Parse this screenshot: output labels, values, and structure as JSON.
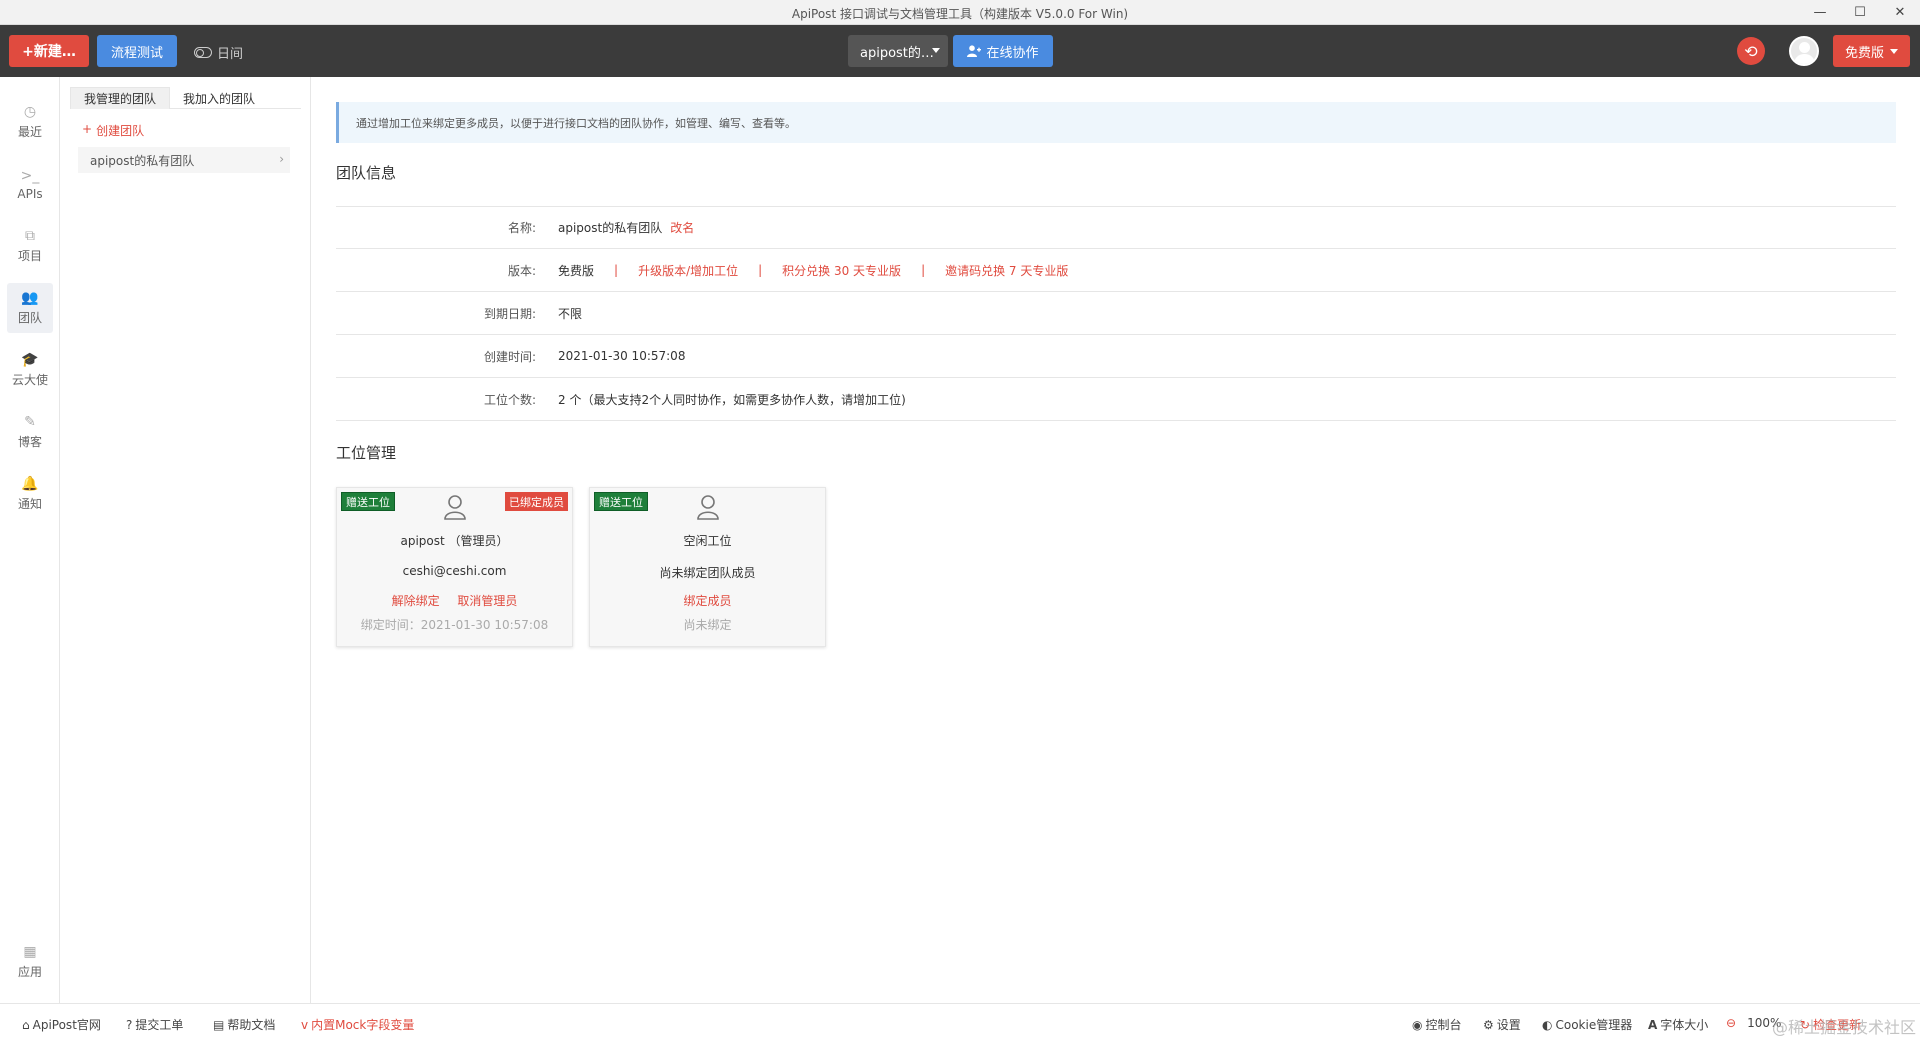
{
  "window": {
    "title": "ApiPost 接口调试与文档管理工具（构建版本 V5.0.0 For Win)",
    "minimize": "—",
    "maximize": "☐",
    "close": "✕"
  },
  "toolbar": {
    "new_label": "+新建…",
    "flow_test_label": "流程测试",
    "night_label": "日间",
    "project_select": "apipost的…",
    "collab_label": "在线协作",
    "plan_label": "免费版"
  },
  "leftnav": [
    {
      "label": "最近",
      "icon": "clock-icon"
    },
    {
      "label": "APIs",
      "icon": "terminal-icon"
    },
    {
      "label": "项目",
      "icon": "project-icon"
    },
    {
      "label": "团队",
      "icon": "users-icon"
    },
    {
      "label": "云大使",
      "icon": "graduation-cap-icon"
    },
    {
      "label": "博客",
      "icon": "edit-icon"
    },
    {
      "label": "通知",
      "icon": "bell-icon"
    },
    {
      "label": "应用",
      "icon": "apps-grid-icon"
    }
  ],
  "subpanel": {
    "tabs": [
      "我管理的团队",
      "我加入的团队"
    ],
    "create_team": "创建团队",
    "teams": [
      "apipost的私有团队"
    ]
  },
  "main": {
    "notice": "通过增加工位来绑定更多成员，以便于进行接口文档的团队协作，如管理、编写、查看等。",
    "team_info_title": "团队信息",
    "rows": {
      "name_label": "名称:",
      "name_value": "apipost的私有团队",
      "rename": "改名",
      "version_label": "版本:",
      "version_value": "免费版",
      "upgrade": "升级版本/增加工位",
      "points_redeem": "积分兑换 30 天专业版",
      "invite_redeem": "邀请码兑换 7 天专业版",
      "expire_label": "到期日期:",
      "expire_value": "不限",
      "created_label": "创建时间:",
      "created_value": "2021-01-30 10:57:08",
      "seats_label": "工位个数:",
      "seats_value": "2 个（最大支持2个人同时协作，如需更多协作人数，请增加工位)"
    },
    "seat_mgmt_title": "工位管理",
    "seats": [
      {
        "badge": "赠送工位",
        "status_badge": "已绑定成员",
        "name": "apipost （管理员）",
        "email": "ceshi@ceshi.com",
        "action1": "解除绑定",
        "action2": "取消管理员",
        "bind_time": "绑定时间：2021-01-30 10:57:08"
      },
      {
        "badge": "赠送工位",
        "name": "空闲工位",
        "email": "尚未绑定团队成员",
        "action1": "绑定成员",
        "bind_time": "尚未绑定"
      }
    ]
  },
  "statusbar": {
    "official_site": "ApiPost官网",
    "submit_ticket": "提交工单",
    "help_docs": "帮助文档",
    "mock_vars": "内置Mock字段变量",
    "console": "控制台",
    "settings": "设置",
    "cookie_manager": "Cookie管理器",
    "font_size": "字体大小",
    "zoom": "100%",
    "check_update": "检查更新",
    "watermark": "@稀土掘金技术社区"
  },
  "colors": {
    "accent_red": "#e04b3f",
    "accent_blue": "#4a8be0",
    "badge_green": "#1e7f3a",
    "toolbar_bg": "#3b3b3b"
  }
}
